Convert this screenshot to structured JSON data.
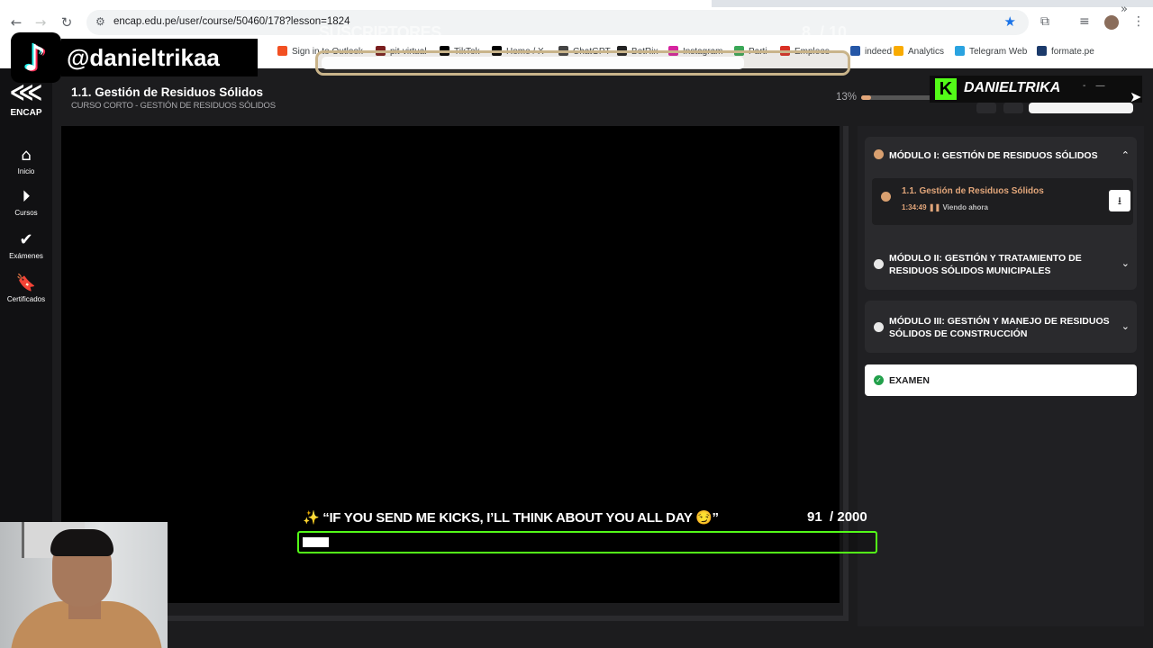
{
  "browser": {
    "nav_back": "←",
    "nav_forward": "→",
    "nav_reload": "↻",
    "url": "encap.edu.pe/user/course/50460/178?lesson=1824",
    "bookmarks": [
      {
        "label": "Sign in to Outlook",
        "color": "#f25022"
      },
      {
        "label": "pit-virtual",
        "color": "#7a1e1e"
      },
      {
        "label": "TikTok",
        "color": "#000000"
      },
      {
        "label": "Home / X",
        "color": "#000000"
      },
      {
        "label": "ChatGPT",
        "color": "#444444"
      },
      {
        "label": "BotRix",
        "color": "#222222"
      },
      {
        "label": "Instagram",
        "color": "#d6249f"
      },
      {
        "label": "Parti",
        "color": "#3aa757"
      },
      {
        "label": "Empleos",
        "color": "#d93025"
      },
      {
        "label": "indeed",
        "color": "#2557a7"
      },
      {
        "label": "Analytics",
        "color": "#f9ab00"
      },
      {
        "label": "Telegram Web",
        "color": "#2aa3e0"
      },
      {
        "label": "formate.pe",
        "color": "#1b3a6b"
      }
    ],
    "bookmarks_more": "»"
  },
  "overlays": {
    "tiktok_handle": "@danieltrikaa",
    "subscriber_goal": {
      "label": "SUSCRIPTORES",
      "current": "8",
      "target": "/ 10",
      "progress": 0.8
    },
    "kick_name": "DANIELTRIKA",
    "kick_goal": {
      "message": "✨ “IF YOU SEND ME KICKS, I’LL THINK ABOUT YOU ALL DAY 😏”",
      "current": "91",
      "target": "/ 2000",
      "progress": 0.0455
    }
  },
  "sidebar": {
    "logo_text": "ENCAP",
    "items": [
      {
        "label": "Inicio",
        "icon": "home-icon"
      },
      {
        "label": "Cursos",
        "icon": "play-circle-icon"
      },
      {
        "label": "Exámenes",
        "icon": "check-icon"
      },
      {
        "label": "Certificados",
        "icon": "bookmark-icon"
      }
    ]
  },
  "header": {
    "title": "1.1. Gestión de Residuos Sólidos",
    "subtitle": "CURSO CORTO - GESTIÓN DE RESIDUOS SÓLIDOS",
    "progress_label": "13%",
    "progress": 0.13
  },
  "modules": [
    {
      "title": "MÓDULO I: GESTIÓN DE RESIDUOS SÓLIDOS",
      "status_color": "#d9a070",
      "expanded": true,
      "lessons": [
        {
          "title": "1.1. Gestión de Residuos Sólidos",
          "duration": "1:34:49",
          "status": "Viendo ahora"
        }
      ]
    },
    {
      "title": "MÓDULO II: GESTIÓN Y TRATAMIENTO DE RESIDUOS SÓLIDOS MUNICIPALES",
      "status_color": "#e8e8e8",
      "expanded": false
    },
    {
      "title": "MÓDULO III: GESTIÓN Y MANEJO DE RESIDUOS SÓLIDOS DE CONSTRUCCIÓN",
      "status_color": "#e8e8e8",
      "expanded": false
    }
  ],
  "exam": {
    "label": "EXAMEN",
    "status_color": "#22a04b"
  },
  "colors": {
    "accent": "#e2a67a",
    "kick_green": "#53fc18"
  }
}
